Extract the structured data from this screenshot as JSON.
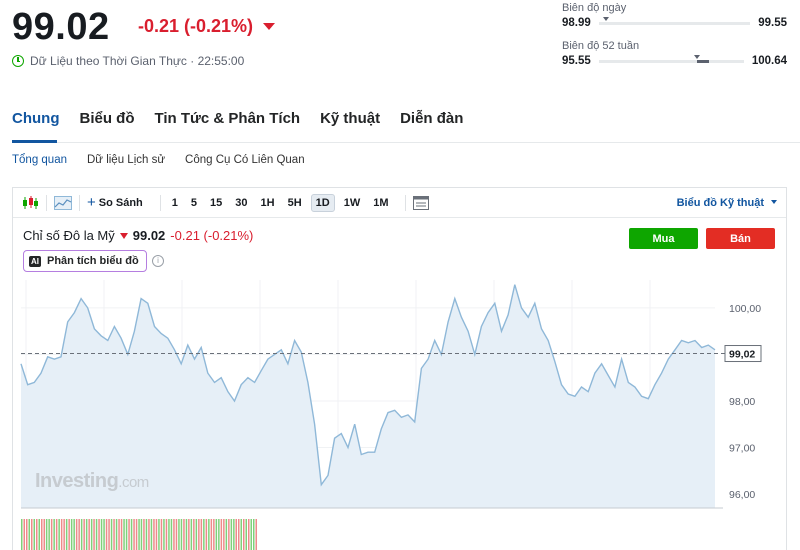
{
  "quote": {
    "price": "99.02",
    "change": "-0.21 (-0.21%)",
    "realtime_label": "Dữ Liệu theo Thời Gian Thực · 22:55:00"
  },
  "day_range": {
    "label": "Biên độ ngày",
    "low": "98.99",
    "high": "99.55",
    "position": 0.05
  },
  "week52_range": {
    "label": "Biên độ 52 tuần",
    "low": "95.55",
    "high": "100.64",
    "position": 0.68
  },
  "main_tabs": [
    {
      "label": "Chung",
      "active": true
    },
    {
      "label": "Biểu đồ"
    },
    {
      "label": "Tin Tức & Phân Tích"
    },
    {
      "label": "Kỹ thuật"
    },
    {
      "label": "Diễn đàn"
    }
  ],
  "sub_tabs": [
    {
      "label": "Tổng quan",
      "active": true
    },
    {
      "label": "Dữ liệu Lịch sử"
    },
    {
      "label": "Công Cụ Có Liên Quan"
    }
  ],
  "toolbar": {
    "compare_label": "So Sánh",
    "intervals": [
      "1",
      "5",
      "15",
      "30",
      "1H",
      "5H",
      "1D",
      "1W",
      "1M"
    ],
    "active_interval": "1D",
    "tech_chart_label": "Biểu đồ Kỹ thuật"
  },
  "chart_header": {
    "name": "Chỉ số Đô la Mỹ",
    "value": "99.02",
    "change": "-0.21 (-0.21%)",
    "ai_badge": "AI",
    "ai_label": "Phân tích biểu đồ",
    "info_icon": "i",
    "buy_label": "Mua",
    "sell_label": "Bán"
  },
  "watermark": {
    "brand": "Investing",
    "suffix": ".com"
  },
  "colors": {
    "up": "#0ea600",
    "down": "#d91e2e",
    "accent": "#1256a0",
    "line": "#8fb8d8",
    "area": "#e6eff7"
  },
  "chart_data": {
    "type": "area",
    "ylim": [
      95.7,
      100.6
    ],
    "yticks": [
      96.0,
      97.0,
      98.0,
      99.0,
      100.0
    ],
    "ytick_labels": [
      "96,00",
      "97,00",
      "98,00",
      "99,00",
      "100,00"
    ],
    "last_value": 99.02,
    "last_label": "99,02",
    "values": [
      98.8,
      98.35,
      98.4,
      98.6,
      98.95,
      98.9,
      98.95,
      99.7,
      99.9,
      100.2,
      100.0,
      99.55,
      99.4,
      99.3,
      99.6,
      99.35,
      99.0,
      99.5,
      100.2,
      100.1,
      99.6,
      99.45,
      99.35,
      99.1,
      98.8,
      99.2,
      98.9,
      99.15,
      98.6,
      98.4,
      98.5,
      98.2,
      98.0,
      98.35,
      98.5,
      98.4,
      98.65,
      98.9,
      99.0,
      99.1,
      98.8,
      99.3,
      99.05,
      98.4,
      97.5,
      96.2,
      96.4,
      97.2,
      97.3,
      97.0,
      97.5,
      96.85,
      96.9,
      96.9,
      97.4,
      97.75,
      97.8,
      97.65,
      97.7,
      97.55,
      98.7,
      98.9,
      99.3,
      99.0,
      99.7,
      100.2,
      99.8,
      99.5,
      99.0,
      99.6,
      99.9,
      100.1,
      99.5,
      99.85,
      100.5,
      100.0,
      99.8,
      100.1,
      99.55,
      99.3,
      98.85,
      98.35,
      98.15,
      98.1,
      98.3,
      98.2,
      98.6,
      98.8,
      98.55,
      98.3,
      98.9,
      98.4,
      98.3,
      98.1,
      98.05,
      98.35,
      98.6,
      98.9,
      99.1,
      99.3,
      99.25,
      99.3,
      99.15,
      99.2,
      99.1
    ],
    "volume_bars": [
      "up",
      "down",
      "down",
      "up",
      "down",
      "up",
      "down",
      "up",
      "down",
      "down",
      "up",
      "up",
      "down",
      "up",
      "down",
      "up",
      "down",
      "down",
      "up",
      "down",
      "up",
      "up",
      "down",
      "down",
      "up",
      "down",
      "up",
      "down",
      "up",
      "down",
      "up",
      "down",
      "up",
      "up",
      "down",
      "down",
      "up",
      "down",
      "up",
      "down",
      "down",
      "up",
      "up",
      "down",
      "up",
      "down",
      "down",
      "up",
      "up",
      "down",
      "up",
      "down",
      "up",
      "down",
      "down",
      "up",
      "down",
      "up",
      "down",
      "up",
      "up",
      "down",
      "down",
      "up",
      "up",
      "down",
      "up",
      "down",
      "up",
      "down",
      "up",
      "down",
      "down",
      "up",
      "down",
      "up",
      "down",
      "down",
      "up",
      "up",
      "down",
      "down",
      "up",
      "down",
      "up",
      "up",
      "down",
      "down",
      "up",
      "down",
      "up",
      "down",
      "up",
      "up",
      "down"
    ]
  }
}
